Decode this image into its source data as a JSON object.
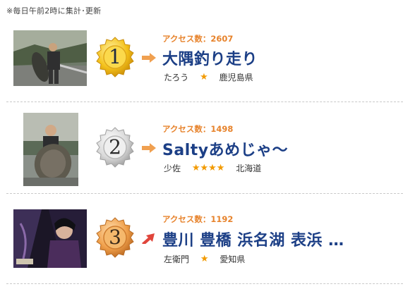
{
  "note": "※毎日午前2時に集計･更新",
  "colors": {
    "access": "#e7832c",
    "title": "#1c3f86",
    "star": "#f29a00",
    "arrow_flat": "#f0a050",
    "arrow_up": "#e0453b"
  },
  "entries": [
    {
      "rank": "1",
      "medal": "gold-medal",
      "trend": "flat-arrow-icon",
      "access_label": "アクセス数：2607",
      "title": "大隅釣り走り",
      "author": "たろう",
      "stars": "★",
      "star_count": 1,
      "region": "鹿児島県"
    },
    {
      "rank": "2",
      "medal": "silver-medal",
      "trend": "flat-arrow-icon",
      "access_label": "アクセス数：1498",
      "title": "Saltyあめじゃ〜",
      "author": "少佐",
      "stars": "★★★★",
      "star_count": 4,
      "region": "北海道"
    },
    {
      "rank": "3",
      "medal": "bronze-medal",
      "trend": "up-arrow-icon",
      "access_label": "アクセス数：1192",
      "title": "豊川 豊橋 浜名湖 表浜 …",
      "author": "左衛門",
      "stars": "★",
      "star_count": 1,
      "region": "愛知県"
    }
  ]
}
